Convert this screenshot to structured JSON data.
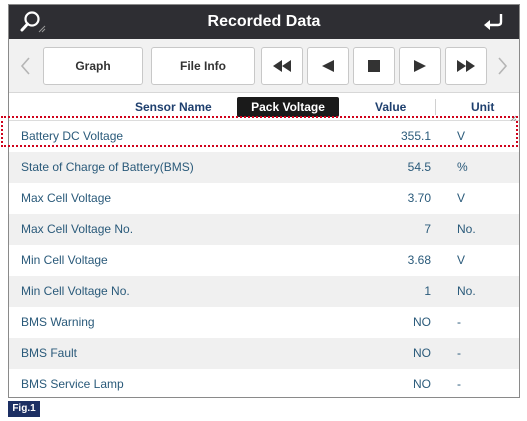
{
  "title": "Recorded Data",
  "toolbar": {
    "graph_label": "Graph",
    "file_info_label": "File Info"
  },
  "header": {
    "sensor_name": "Sensor Name",
    "pack_voltage": "Pack Voltage",
    "value": "Value",
    "unit": "Unit"
  },
  "rows": [
    {
      "name": "Battery DC Voltage",
      "value": "355.1",
      "unit": "V"
    },
    {
      "name": "State of Charge of Battery(BMS)",
      "value": "54.5",
      "unit": "%"
    },
    {
      "name": "Max Cell Voltage",
      "value": "3.70",
      "unit": "V"
    },
    {
      "name": "Max Cell Voltage No.",
      "value": "7",
      "unit": "No."
    },
    {
      "name": "Min Cell Voltage",
      "value": "3.68",
      "unit": "V"
    },
    {
      "name": "Min Cell Voltage No.",
      "value": "1",
      "unit": "No."
    },
    {
      "name": "BMS Warning",
      "value": "NO",
      "unit": "-"
    },
    {
      "name": "BMS Fault",
      "value": "NO",
      "unit": "-"
    },
    {
      "name": "BMS Service Lamp",
      "value": "NO",
      "unit": "-"
    }
  ],
  "figure_label": "Fig.1",
  "colors": {
    "titlebar": "#2e2e33",
    "header_text": "#1e3f6e",
    "row_text": "#2a5a7a",
    "highlight": "#d0021b",
    "fig_badge": "#1c2f63"
  }
}
